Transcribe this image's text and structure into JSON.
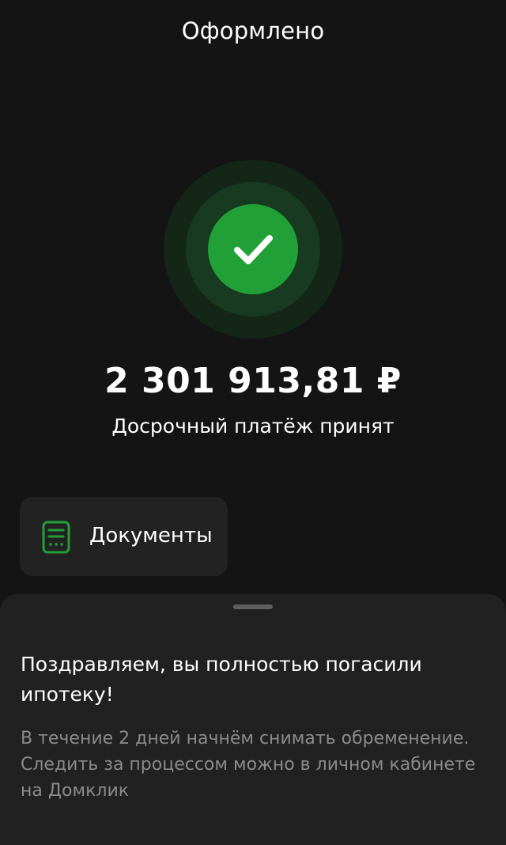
{
  "header": {
    "title": "Оформлено"
  },
  "status": {
    "icon": "checkmark-icon",
    "accent_color": "#21A038",
    "amount": "2 301 913,81 ₽",
    "message": "Досрочный платёж принят"
  },
  "documents": {
    "icon": "document-icon",
    "label": "Документы"
  },
  "sheet": {
    "title": "Поздравляем, вы полностью погасили ипотеку!",
    "description_line1": "В течение 2 дней начнём снимать обременение.",
    "description_line2": "Следить за процессом можно в личном кабинете на Домклик"
  }
}
